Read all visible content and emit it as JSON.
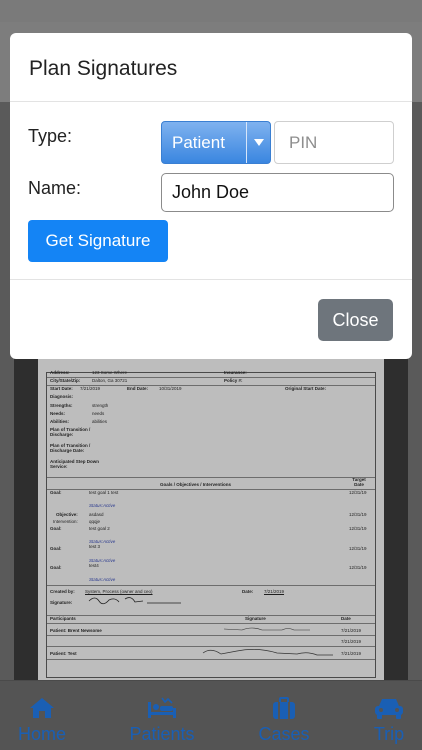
{
  "modal": {
    "title": "Plan Signatures",
    "type_label": "Type:",
    "type_value": "Patient",
    "pin_placeholder": "PIN",
    "name_label": "Name:",
    "name_value": "John Doe",
    "get_signature_label": "Get Signature",
    "close_label": "Close"
  },
  "document": {
    "address_label": "Address:",
    "address_value": "123 Some Where",
    "city_label": "City/State/Zip:",
    "city_value": "Dalton, Ga 30721",
    "insurance_label": "Insurance:",
    "policy_label": "Policy #:",
    "start_date_label": "Start Date:",
    "start_date_value": "7/21/2019",
    "end_date_label": "End Date:",
    "end_date_value": "10/31/2019",
    "original_start_label": "Original Start Date:",
    "diagnosis_label": "Diagnosis:",
    "strengths_label": "Strengths:",
    "strengths_value": "strength",
    "needs_label": "Needs:",
    "needs_value": "needs",
    "abilities_label": "Abilities:",
    "abilities_value": "abilities",
    "transition_label": "Plan of Transition / Discharge:",
    "transition_date_label": "Plan of Transition / Discharge Date:",
    "stepdown_label": "Anticipated Step Down Service:",
    "goals_header": "Goals / Objectives / Interventions",
    "target_header": "Target Date",
    "goals": [
      {
        "label": "Goal:",
        "text": "test goal 1 test",
        "date": "12/31/19"
      },
      {
        "status": "Status:Active"
      },
      {
        "label": "Objective:",
        "text": "asdasd",
        "date": "12/31/19"
      },
      {
        "label": "Intervention:",
        "text": "qqqje",
        "date": ""
      },
      {
        "label": "Goal:",
        "text": "test goal 2",
        "date": "12/31/19"
      },
      {
        "status": "Status:Active"
      },
      {
        "label": "Goal:",
        "text": "test 3",
        "date": "12/31/19"
      },
      {
        "status": "Status:Active"
      },
      {
        "label": "Goal:",
        "text": "test4",
        "date": "12/31/19"
      },
      {
        "status": "Status:Active"
      }
    ],
    "created_by_label": "Created by:",
    "created_by_value": "System, Process (owner and ceo)",
    "date_label": "Date:",
    "date_value": "7/21/2019",
    "signature_label": "Signature:",
    "participants_header": "Participants",
    "signature_header": "Signature",
    "date_header": "Date",
    "participants": [
      {
        "name": "Patient: Brent Newsome",
        "date": "7/21/2019"
      },
      {
        "name": "",
        "date": "7/21/2019"
      },
      {
        "name": "Patient: Test",
        "date": "7/21/2019"
      }
    ]
  },
  "tabs": [
    {
      "label": "Home",
      "icon": "home-icon"
    },
    {
      "label": "Patients",
      "icon": "patient-bed-icon"
    },
    {
      "label": "Cases",
      "icon": "briefcase-icon"
    },
    {
      "label": "Trip",
      "icon": "car-icon"
    }
  ],
  "colors": {
    "accent": "#1484f5",
    "tab_label": "#1a5fb4",
    "close_button": "#6e757c"
  }
}
